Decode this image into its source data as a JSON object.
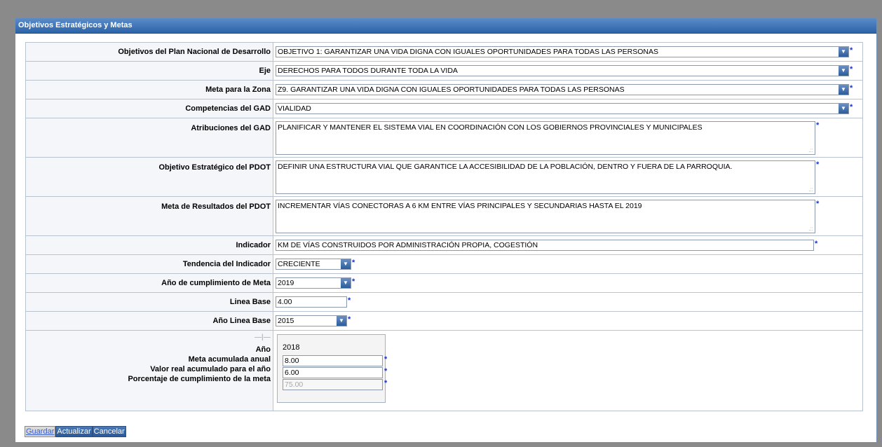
{
  "panel": {
    "title": "Objetivos Estratégicos y Metas"
  },
  "required_mark": "*",
  "fields": {
    "objetivos_pnd": {
      "label": "Objetivos del Plan Nacional de Desarrollo",
      "value": "OBJETIVO 1: GARANTIZAR UNA VIDA DIGNA CON IGUALES OPORTUNIDADES PARA TODAS LAS PERSONAS"
    },
    "eje": {
      "label": "Eje",
      "value": "DERECHOS PARA TODOS DURANTE TODA LA VIDA"
    },
    "meta_zona": {
      "label": "Meta para la Zona",
      "value": "Z9. GARANTIZAR UNA VIDA DIGNA CON IGUALES OPORTUNIDADES PARA TODAS LAS PERSONAS"
    },
    "competencias": {
      "label": "Competencias del GAD",
      "value": "VIALIDAD"
    },
    "atribuciones": {
      "label": "Atribuciones del GAD",
      "value": "PLANIFICAR Y MANTENER EL SISTEMA VIAL EN COORDINACIÓN CON LOS GOBIERNOS PROVINCIALES Y MUNICIPALES"
    },
    "objetivo_pdot": {
      "label": "Objetivo Estratégico del PDOT",
      "value": "DEFINIR UNA ESTRUCTURA VIAL QUE GARANTICE LA ACCESIBILIDAD DE LA POBLACIÓN, DENTRO Y FUERA DE LA PARROQUIA."
    },
    "meta_pdot": {
      "label": "Meta de Resultados del PDOT",
      "value": "INCREMENTAR VÍAS CONECTORAS A 6 KM ENTRE VÍAS PRINCIPALES Y SECUNDARIAS HASTA EL 2019"
    },
    "indicador": {
      "label": "Indicador",
      "value": "KM DE VÍAS CONSTRUIDOS POR ADMINISTRACIÓN PROPIA, COGESTIÓN"
    },
    "tendencia": {
      "label": "Tendencia del Indicador",
      "value": "CRECIENTE"
    },
    "anio_meta": {
      "label": "Año de cumplimiento de Meta",
      "value": "2019"
    },
    "linea_base": {
      "label": "Linea Base",
      "value": "4.00"
    },
    "anio_linea_base": {
      "label": "Año Linea Base",
      "value": "2015"
    }
  },
  "annual": {
    "labels": {
      "anio": "Año",
      "meta": "Meta acumulada anual",
      "valor": "Valor real acumulado para el año",
      "porcentaje": "Porcentaje de cumplimiento de la meta"
    },
    "year": "2018",
    "meta": "8.00",
    "valor": "6.00",
    "porcentaje": "75.00"
  },
  "buttons": {
    "guardar": "Guardar",
    "actualizar": "Actualizar",
    "cancelar": "Cancelar"
  },
  "colors": {
    "header": "#2d63a8",
    "required": "#1a34c9",
    "border": "#b9c3cf"
  },
  "icons": {
    "dropdown": "chevron-down-icon",
    "resize": "resize-grip-icon"
  }
}
